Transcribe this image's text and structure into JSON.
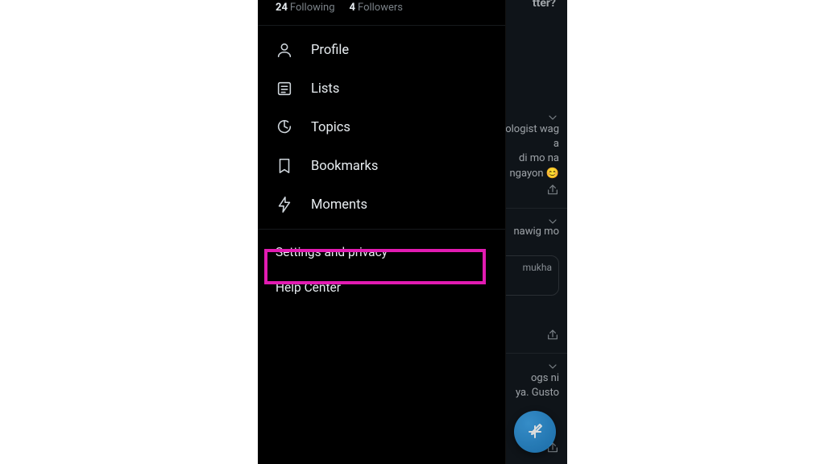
{
  "stats": {
    "following_count": "24",
    "following_label": "Following",
    "followers_count": "4",
    "followers_label": "Followers"
  },
  "menu": {
    "profile": "Profile",
    "lists": "Lists",
    "topics": "Topics",
    "bookmarks": "Bookmarks",
    "moments": "Moments"
  },
  "secondary": {
    "settings": "Settings and privacy",
    "help": "Help Center"
  },
  "background": {
    "header_fragment": "tter?",
    "tweet1_line1": "ologist wag",
    "tweet1_line2": "a",
    "tweet1_line3": "di mo na",
    "tweet1_line4": "ngayon 😊",
    "tweet2_line1": "nawig mo",
    "tweet2_quote": "mukha",
    "tweet3_line1": "ogs ni",
    "tweet3_line2": "ya. Gusto"
  }
}
